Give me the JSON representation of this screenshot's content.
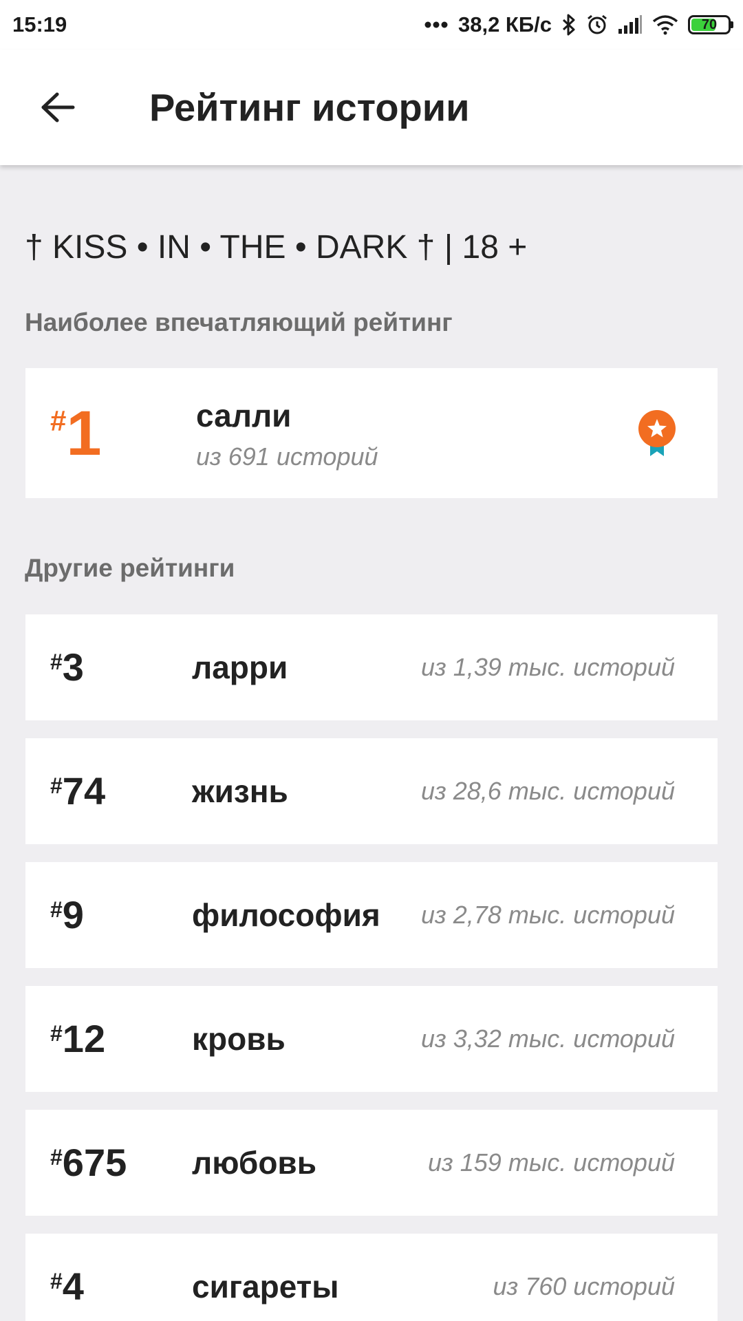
{
  "status_bar": {
    "time": "15:19",
    "network_speed": "38,2 КБ/с",
    "battery_level": "70",
    "battery_percent": 70,
    "icons": [
      "more-dots-icon",
      "bluetooth-icon",
      "alarm-icon",
      "signal-icon",
      "wifi-icon",
      "battery-icon"
    ]
  },
  "header": {
    "back_icon": "arrow-left-icon",
    "title": "Рейтинг истории"
  },
  "story": {
    "title": "† KISS • IN • THE • DARK † | 18 +"
  },
  "top_section": {
    "label": "Наиболее впечатляющий рейтинг",
    "hash": "#",
    "rank": "1",
    "tag": "салли",
    "count": "из 691 историй",
    "icon": "ribbon-medal-icon",
    "accent_color": "#f26d21",
    "ribbon_color": "#1aa3b8"
  },
  "other_section": {
    "label": "Другие рейтинги",
    "hash": "#",
    "items": [
      {
        "rank": "3",
        "tag": "ларри",
        "count": "из 1,39 тыс. историй"
      },
      {
        "rank": "74",
        "tag": "жизнь",
        "count": "из 28,6 тыс. историй"
      },
      {
        "rank": "9",
        "tag": "философия",
        "count": "из 2,78 тыс. историй"
      },
      {
        "rank": "12",
        "tag": "кровь",
        "count": "из 3,32 тыс. историй"
      },
      {
        "rank": "675",
        "tag": "любовь",
        "count": "из 159 тыс. историй"
      },
      {
        "rank": "4",
        "tag": "сигареты",
        "count": "из 760 историй"
      }
    ]
  }
}
